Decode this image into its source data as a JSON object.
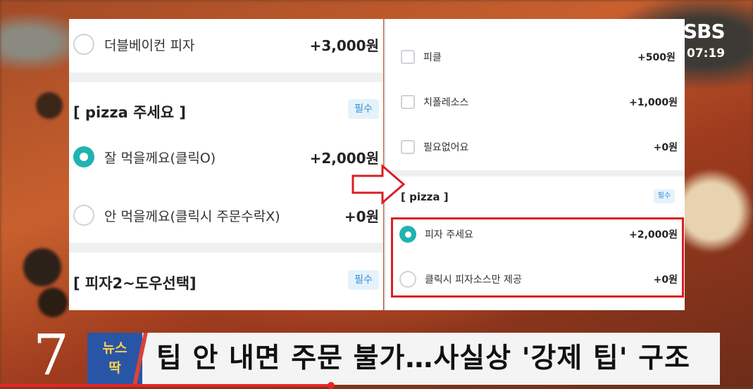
{
  "left": {
    "top_item": {
      "label": "더블베이컨 피자",
      "price": "+3,000원"
    },
    "section1": {
      "title": "[ pizza 주세요 ]",
      "badge": "필수",
      "options": [
        {
          "label": "잘 먹을께요(클릭O)",
          "price": "+2,000원",
          "selected": true
        },
        {
          "label": "안 먹을께요(클릭시 주문수락X)",
          "price": "+0원",
          "selected": false
        }
      ]
    },
    "section2": {
      "title": "[ 피자2~도우선택]",
      "badge": "필수"
    }
  },
  "right": {
    "checks": [
      {
        "label": "피클",
        "price": "+500원"
      },
      {
        "label": "치폴레소스",
        "price": "+1,000원"
      },
      {
        "label": "필요없어요",
        "price": "+0원"
      }
    ],
    "section": {
      "title": "[ pizza ]",
      "badge": "필수",
      "options": [
        {
          "label": "피자 주세요",
          "price": "+2,000원",
          "selected": true
        },
        {
          "label": "클릭시 피자소스만 제공",
          "price": "+0원",
          "selected": false
        }
      ]
    }
  },
  "broadcast": {
    "logo": "SBS",
    "time": "07:19"
  },
  "caption": {
    "number": "7",
    "badge_line1": "뉴스",
    "badge_line2": "딱",
    "headline": "팁 안 내면 주문 불가…사실상 '강제 팁' 구조"
  },
  "colors": {
    "accent": "#1fb3b0",
    "highlight": "#d81f26",
    "badge_bg": "#2955a6",
    "badge_text": "#ffd24a"
  }
}
